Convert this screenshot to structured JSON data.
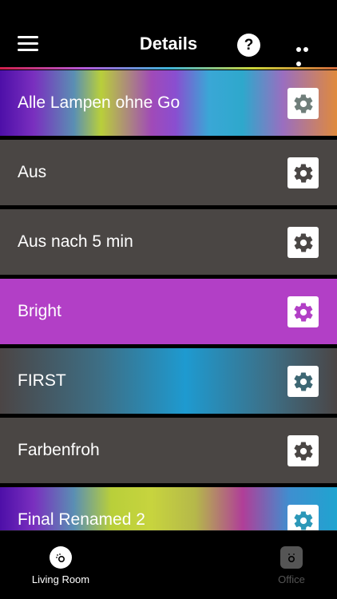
{
  "header": {
    "title": "Details",
    "help_label": "?"
  },
  "rows": [
    {
      "label": "Alle Lampen ohne Go",
      "style": "rainbow-a",
      "gear_color": "#6f7e7a"
    },
    {
      "label": "Aus",
      "style": "solid",
      "bg": "#4a4644",
      "gear_color": "#4a4644"
    },
    {
      "label": "Aus nach 5 min",
      "style": "solid",
      "bg": "#4a4644",
      "gear_color": "#4a4644"
    },
    {
      "label": "Bright",
      "style": "solid",
      "bg": "#b23fc6",
      "gear_color": "#b23fc6"
    },
    {
      "label": "FIRST",
      "style": "blue",
      "gear_color": "#3d6773"
    },
    {
      "label": "Farbenfroh",
      "style": "solid",
      "bg": "#4a4644",
      "gear_color": "#4a4644"
    },
    {
      "label": "Final Renamed 2",
      "style": "rainbow-b",
      "gear_color": "#2c98b8"
    }
  ],
  "tabs": [
    {
      "label": "Living Room",
      "active": true
    },
    {
      "label": "Office",
      "active": false
    }
  ]
}
